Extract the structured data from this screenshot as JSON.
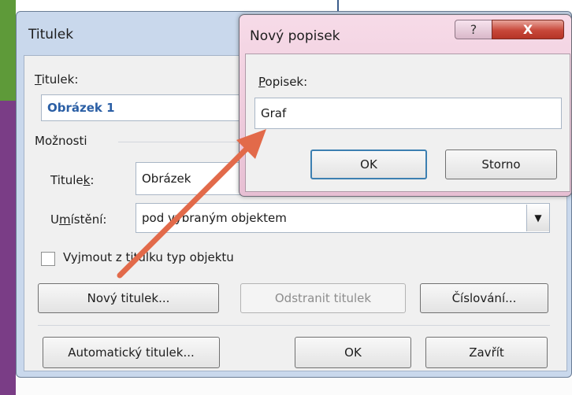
{
  "main_dialog": {
    "title": "Titulek",
    "caption_label": "Titulek:",
    "caption_value": "Obrázek 1",
    "options_group": "Možnosti",
    "label_field_label": "Titulek:",
    "label_field_value": "Obrázek",
    "position_label": "Umístění:",
    "position_value": "pod vybraným objektem",
    "exclude_label": "Vyjmout z titulku typ objektu",
    "new_label_button": "Nový titulek...",
    "delete_label_button": "Odstranit titulek",
    "numbering_button": "Číslování...",
    "autocaption_button": "Automatický titulek...",
    "ok_button": "OK",
    "close_button": "Zavřít"
  },
  "popup_dialog": {
    "title": "Nový popisek",
    "label_caption": "Popisek:",
    "label_value": "Graf",
    "ok_button": "OK",
    "cancel_button": "Storno",
    "help_glyph": "?",
    "close_glyph": "X"
  },
  "annotation": {
    "arrow_color": "#e26a4a"
  },
  "colors": {
    "accent_text": "#2b5fa5",
    "frame": "#c9d8ec",
    "popup_frame": "#f0cfe0",
    "close": "#c8483a"
  }
}
